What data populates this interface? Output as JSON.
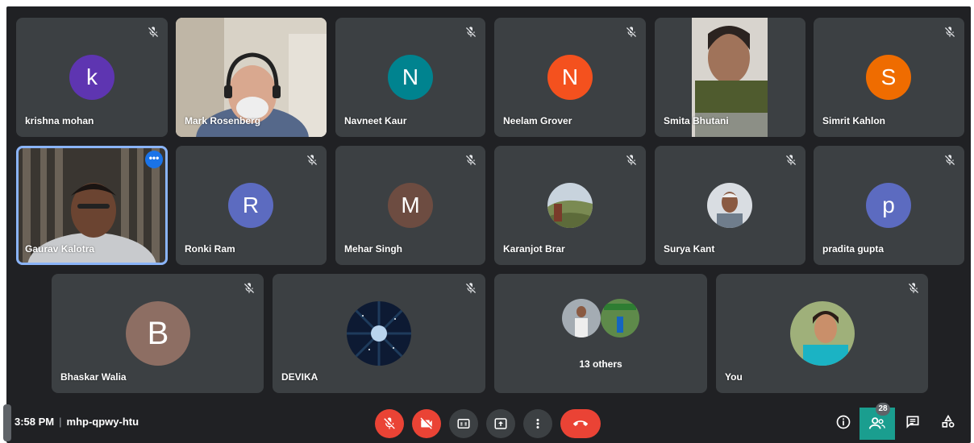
{
  "tiles": {
    "krishna": {
      "name": "krishna mohan",
      "initial": "k",
      "color": "#5e35b1"
    },
    "mark": {
      "name": "Mark Rosenberg"
    },
    "navneet": {
      "name": "Navneet Kaur",
      "initial": "N",
      "color": "#00838f"
    },
    "neelam": {
      "name": "Neelam Grover",
      "initial": "N",
      "color": "#f4511e"
    },
    "smita": {
      "name": "Smita Bhutani"
    },
    "simrit": {
      "name": "Simrit Kahlon",
      "initial": "S",
      "color": "#ef6c00"
    },
    "gaurav": {
      "name": "Gaurav Kalotra"
    },
    "ronki": {
      "name": "Ronki Ram",
      "initial": "R",
      "color": "#5c6bc0"
    },
    "mehar": {
      "name": "Mehar Singh",
      "initial": "M",
      "color": "#6d4c41"
    },
    "karanjot": {
      "name": "Karanjot Brar"
    },
    "surya": {
      "name": "Surya Kant"
    },
    "pradita": {
      "name": "pradita gupta",
      "initial": "p",
      "color": "#5c6bc0"
    },
    "bhaskar": {
      "name": "Bhaskar Walia",
      "initial": "B",
      "color": "#8d6e63"
    },
    "devika": {
      "name": "DEVIKA"
    },
    "others": {
      "label": "13 others"
    },
    "you": {
      "name": "You"
    }
  },
  "meeting": {
    "time": "3:58 PM",
    "code": "mhp-qpwy-htu"
  },
  "controls": {
    "mic": "mic-off-icon",
    "camera": "camera-off-icon",
    "captions": "captions-icon",
    "present": "present-icon",
    "more": "more-vert-icon",
    "leave": "leave-call-icon"
  },
  "people_count": "28",
  "colors": {
    "background": "#202124",
    "tile": "#3c4043",
    "accent_red": "#ea4335",
    "active_outline": "#8ab4f8",
    "people_button": "#1a9e8f"
  }
}
